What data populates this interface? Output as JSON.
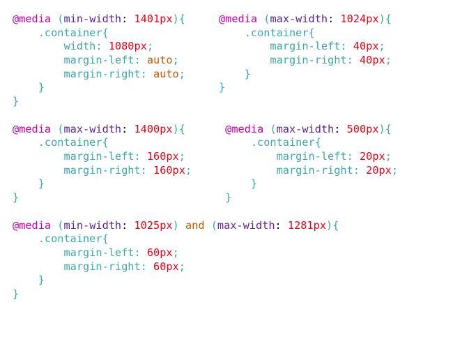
{
  "queries": [
    {
      "feature": "min-width",
      "value": "1401px",
      "and": null,
      "decls": [
        {
          "prop": "width",
          "value": "1080px"
        },
        {
          "prop": "margin-left",
          "value": "auto"
        },
        {
          "prop": "margin-right",
          "value": "auto"
        }
      ]
    },
    {
      "feature": "max-width",
      "value": "1024px",
      "and": null,
      "decls": [
        {
          "prop": "margin-left",
          "value": "40px"
        },
        {
          "prop": "margin-right",
          "value": "40px"
        }
      ]
    },
    {
      "feature": "max-width",
      "value": "1400px",
      "and": null,
      "decls": [
        {
          "prop": "margin-left",
          "value": "160px"
        },
        {
          "prop": "margin-right",
          "value": "160px"
        }
      ]
    },
    {
      "feature": "max-width",
      "value": "500px",
      "and": null,
      "decls": [
        {
          "prop": "margin-left",
          "value": "20px"
        },
        {
          "prop": "margin-right",
          "value": "20px"
        }
      ]
    },
    {
      "feature": "min-width",
      "value": "1025px",
      "and": {
        "feature": "max-width",
        "value": "1281px"
      },
      "decls": [
        {
          "prop": "margin-left",
          "value": "60px"
        },
        {
          "prop": "margin-right",
          "value": "60px"
        }
      ]
    }
  ],
  "selector": ".container",
  "autoKeyword": "auto"
}
